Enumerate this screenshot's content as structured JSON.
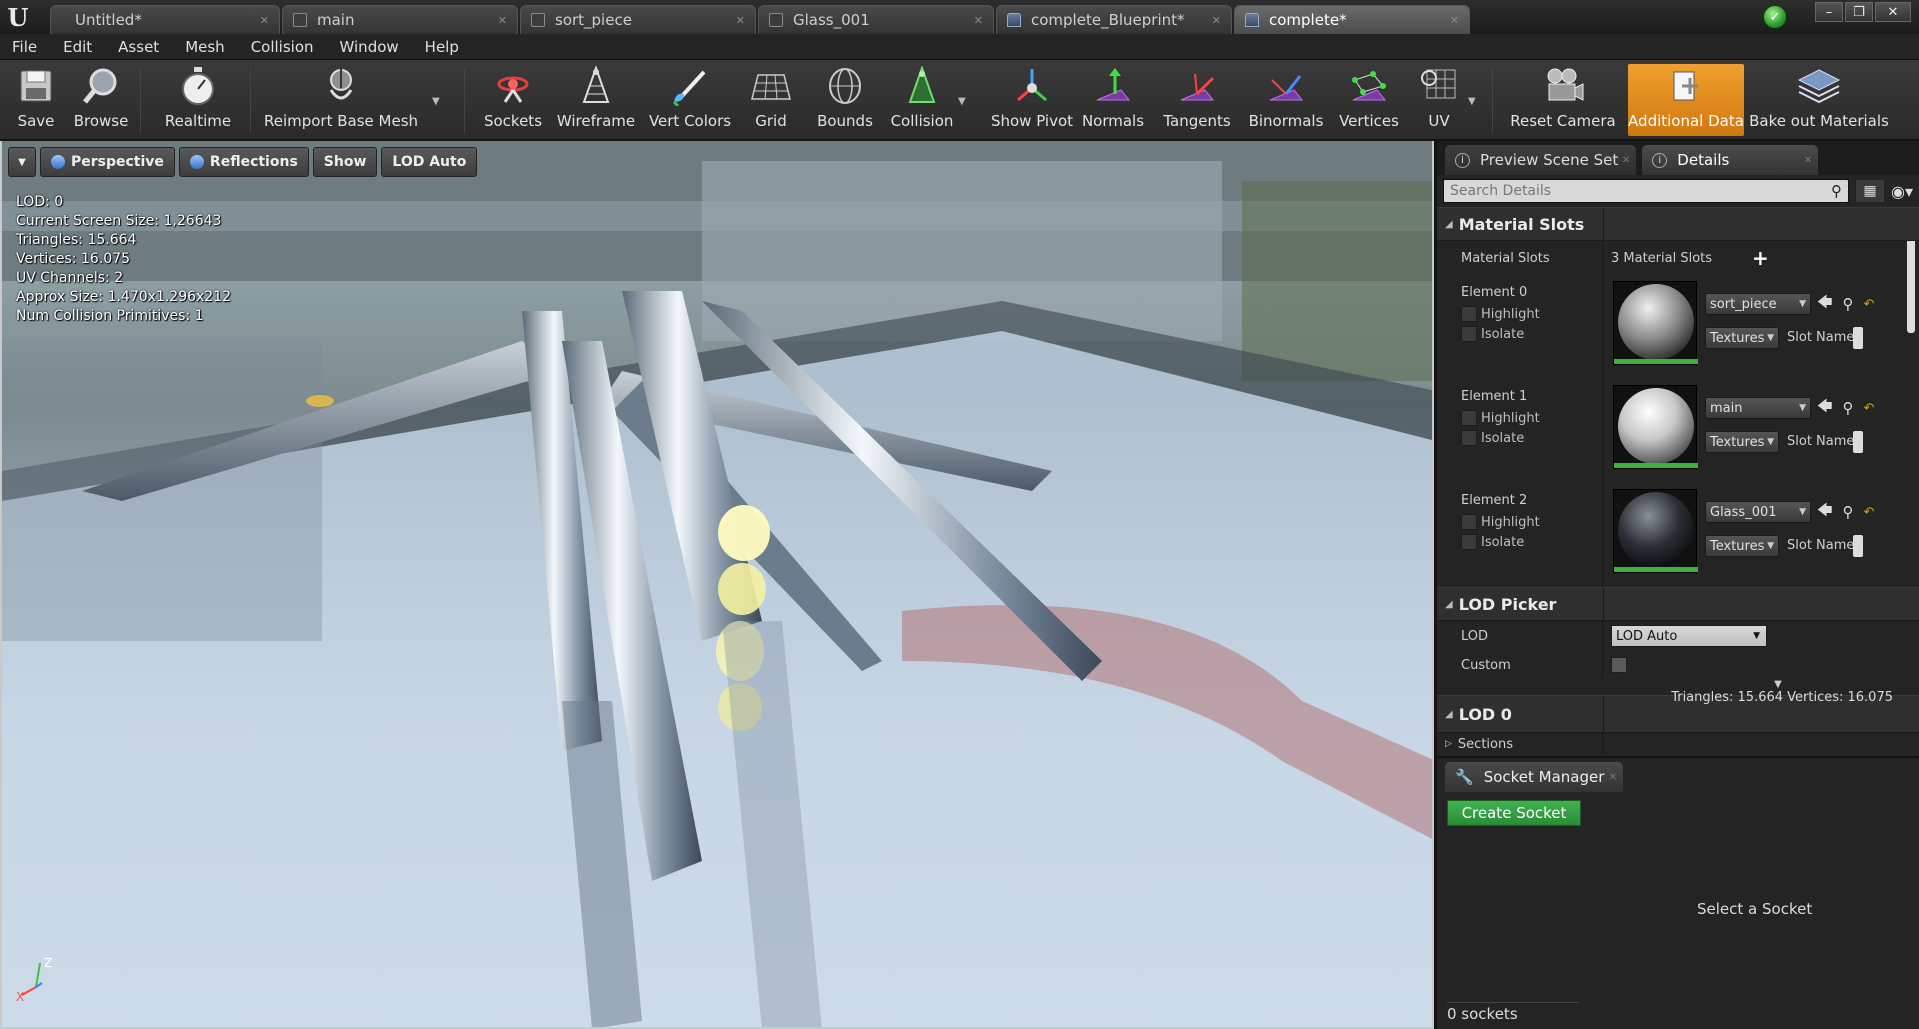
{
  "tabs": [
    {
      "label": "Untitled*",
      "icon": "none"
    },
    {
      "label": "main",
      "icon": "asset"
    },
    {
      "label": "sort_piece",
      "icon": "asset"
    },
    {
      "label": "Glass_001",
      "icon": "asset"
    },
    {
      "label": "complete_Blueprint*",
      "icon": "blueprint"
    },
    {
      "label": "complete*",
      "icon": "blueprint"
    }
  ],
  "menu": [
    "File",
    "Edit",
    "Asset",
    "Mesh",
    "Collision",
    "Window",
    "Help"
  ],
  "toolbar": {
    "save": "Save",
    "browse": "Browse",
    "realtime": "Realtime",
    "reimport": "Reimport Base Mesh",
    "sockets": "Sockets",
    "wireframe": "Wireframe",
    "vert_colors": "Vert Colors",
    "grid": "Grid",
    "bounds": "Bounds",
    "collision": "Collision",
    "show_pivot": "Show Pivot",
    "normals": "Normals",
    "tangents": "Tangents",
    "binormals": "Binormals",
    "vertices": "Vertices",
    "uv": "UV",
    "reset_camera": "Reset Camera",
    "additional_data": "Additional Data",
    "bake_out": "Bake out Materials"
  },
  "viewport": {
    "perspective": "Perspective",
    "reflections": "Reflections",
    "show": "Show",
    "lod_auto": "LOD Auto",
    "stats": [
      "LOD:  0",
      "Current Screen Size:  1,26643",
      "Triangles:  15.664",
      "Vertices:  16.075",
      "UV Channels:  2",
      "Approx Size: 1.470x1.296x212",
      "Num Collision Primitives:  1"
    ],
    "axis_z": "Z",
    "axis_x": "X"
  },
  "details": {
    "tab_preview": "Preview Scene Set",
    "tab_details": "Details",
    "search_placeholder": "Search Details",
    "material_slots_title": "Material Slots",
    "material_slots_label": "Material Slots",
    "material_slots_value": "3 Material Slots",
    "highlight": "Highlight",
    "isolate": "Isolate",
    "textures": "Textures",
    "slot_name": "Slot Name",
    "elements": [
      {
        "name": "Element 0",
        "material": "sort_piece"
      },
      {
        "name": "Element 1",
        "material": "main"
      },
      {
        "name": "Element 2",
        "material": "Glass_001"
      }
    ],
    "lod_picker_title": "LOD Picker",
    "lod_label": "LOD",
    "lod_value": "LOD Auto",
    "custom_label": "Custom",
    "lod0_title": "LOD 0",
    "lod0_stats": "Triangles: 15.664    Vertices: 16.075",
    "sections": "Sections"
  },
  "sockets": {
    "tab": "Socket Manager",
    "create": "Create Socket",
    "select_msg": "Select a Socket",
    "count": "0 sockets"
  }
}
